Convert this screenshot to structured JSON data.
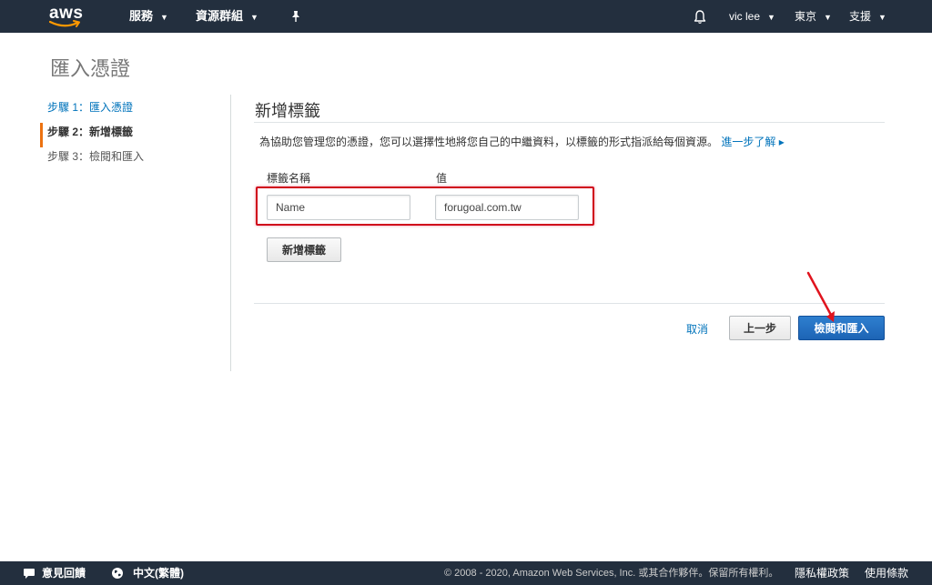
{
  "nav": {
    "logo_text": "aws",
    "services": "服務",
    "resource_groups": "資源群組",
    "user": "vic lee",
    "region": "東京",
    "support": "支援"
  },
  "page_title": "匯入憑證",
  "steps": [
    {
      "label": "步驟 1：匯入憑證",
      "state": "link"
    },
    {
      "label": "步驟 2：新增標籤",
      "state": "active"
    },
    {
      "label": "步驟 3：檢閱和匯入",
      "state": "pending"
    }
  ],
  "section_title": "新增標籤",
  "description": "為協助您管理您的憑證，您可以選擇性地將您自己的中繼資料，以標籤的形式指派給每個資源。",
  "learn_more": "進一步了解",
  "table": {
    "key_header": "標籤名稱",
    "value_header": "值",
    "key_value": "Name",
    "value_value": "forugoal.com.tw"
  },
  "add_tag_button": "新增標籤",
  "footer_actions": {
    "cancel": "取消",
    "previous": "上一步",
    "review_import": "檢閱和匯入"
  },
  "footer": {
    "feedback": "意見回饋",
    "language": "中文(繁體)",
    "copyright": "© 2008 - 2020, Amazon Web Services, Inc. 或其合作夥伴。保留所有權利。",
    "privacy": "隱私權政策",
    "terms": "使用條款"
  },
  "colors": {
    "nav_bg": "#232f3e",
    "link": "#0073bb",
    "active_step_bar": "#ec7211",
    "primary_button": "#1d64b5",
    "highlight": "#d0021b"
  },
  "icons": [
    "aws-smile-icon",
    "pin-icon",
    "bell-icon",
    "speech-bubble-icon",
    "globe-icon",
    "arrow-annotation-icon"
  ]
}
